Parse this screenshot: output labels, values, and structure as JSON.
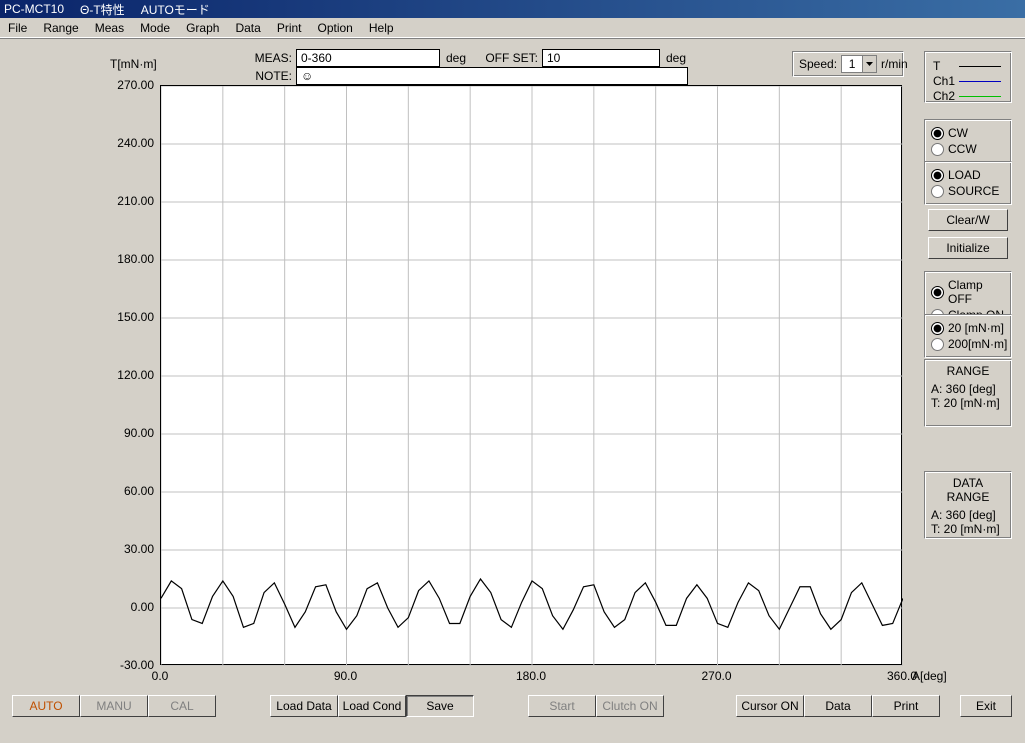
{
  "title": {
    "app": "PC-MCT10",
    "sub": "Θ-T特性",
    "mode": "AUTOモード"
  },
  "menu": [
    "File",
    "Range",
    "Meas",
    "Mode",
    "Graph",
    "Data",
    "Print",
    "Option",
    "Help"
  ],
  "header": {
    "meas_label": "MEAS:",
    "meas_value": "0-360",
    "meas_unit": "deg",
    "note_label": "NOTE:",
    "note_value": "☺",
    "offset_label": "OFF SET:",
    "offset_value": "10",
    "offset_unit": "deg"
  },
  "speed": {
    "label": "Speed:",
    "value": "1",
    "unit": "r/min"
  },
  "legend": {
    "T": "T",
    "Ch1": "Ch1",
    "Ch2": "Ch2"
  },
  "radios": {
    "dir": {
      "cw": "CW",
      "ccw": "CCW"
    },
    "ls": {
      "load": "LOAD",
      "source": "SOURCE"
    },
    "clamp": {
      "off": "Clamp OFF",
      "on": "Clamp ON"
    },
    "units": {
      "u20": "20 [mN·m]",
      "u200": "200[mN·m]"
    }
  },
  "buttons": {
    "clearw": "Clear/W",
    "init": "Initialize"
  },
  "range_box": {
    "title": "RANGE",
    "a": "A:  360  [deg]",
    "t": "T:  20 [mN·m]"
  },
  "datarange_box": {
    "title": "DATA RANGE",
    "a": "A:  360  [deg]",
    "t": "T: 20  [mN·m]"
  },
  "bottom": {
    "auto": "AUTO",
    "manu": "MANU",
    "cal": "CAL",
    "loaddata": "Load Data",
    "loadcond": "Load Cond",
    "save": "Save",
    "start": "Start",
    "clutch": "Clutch ON",
    "cursor": "Cursor ON",
    "data": "Data",
    "print": "Print",
    "exit": "Exit"
  },
  "axes": {
    "y_label": "T[mN·m]",
    "y_ticks": [
      "270.00",
      "240.00",
      "210.00",
      "180.00",
      "150.00",
      "120.00",
      "90.00",
      "60.00",
      "30.00",
      "0.00",
      "-30.00"
    ],
    "x_ticks": [
      "0.0",
      "90.0",
      "180.0",
      "270.0",
      "360.0"
    ],
    "x_label": "A[deg]"
  },
  "chart_data": {
    "type": "line",
    "title": "",
    "xlabel": "A[deg]",
    "ylabel": "T[mN·m]",
    "xlim": [
      0,
      360
    ],
    "ylim": [
      -30,
      270
    ],
    "x_ticks": [
      0,
      90,
      180,
      270,
      360
    ],
    "y_ticks": [
      -30,
      0,
      30,
      60,
      90,
      120,
      150,
      180,
      210,
      240,
      270
    ],
    "series": [
      {
        "name": "T",
        "color": "#000000",
        "x": [
          0,
          5,
          10,
          15,
          20,
          25,
          30,
          35,
          40,
          45,
          50,
          55,
          60,
          65,
          70,
          75,
          80,
          85,
          90,
          95,
          100,
          105,
          110,
          115,
          120,
          125,
          130,
          135,
          140,
          145,
          150,
          155,
          160,
          165,
          170,
          175,
          180,
          185,
          190,
          195,
          200,
          205,
          210,
          215,
          220,
          225,
          230,
          235,
          240,
          245,
          250,
          255,
          260,
          265,
          270,
          275,
          280,
          285,
          290,
          295,
          300,
          305,
          310,
          315,
          320,
          325,
          330,
          335,
          340,
          345,
          350,
          355,
          360
        ],
        "y": [
          5,
          14,
          10,
          -6,
          -8,
          6,
          14,
          6,
          -10,
          -8,
          8,
          13,
          2,
          -10,
          -2,
          11,
          12,
          -2,
          -11,
          -4,
          10,
          13,
          0,
          -10,
          -5,
          9,
          14,
          5,
          -8,
          -8,
          6,
          15,
          8,
          -6,
          -10,
          3,
          14,
          10,
          -4,
          -11,
          -1,
          11,
          12,
          -2,
          -10,
          -6,
          8,
          13,
          3,
          -9,
          -9,
          5,
          12,
          5,
          -8,
          -10,
          3,
          13,
          9,
          -4,
          -11,
          0,
          11,
          11,
          -3,
          -11,
          -6,
          8,
          13,
          2,
          -9,
          -8,
          5
        ]
      }
    ]
  }
}
